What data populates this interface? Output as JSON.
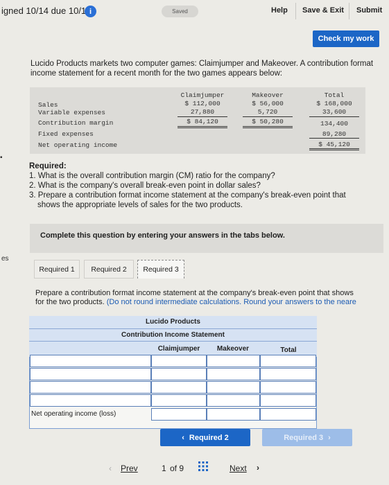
{
  "header": {
    "assignment": "igned 10/14 due 10/19",
    "info_icon": "i",
    "saved": "Saved",
    "help": "Help",
    "save_exit": "Save & Exit",
    "submit": "Submit"
  },
  "check_button": "Check my work",
  "intro": "Lucido Products markets two computer games: Claimjumper and Makeover. A contribution format income statement for a recent month for the two games appears below:",
  "given_table": {
    "columns": [
      "Claimjumper",
      "Makeover",
      "Total"
    ],
    "rows": [
      {
        "label": "Sales",
        "claimjumper": "$ 112,000",
        "makeover": "$ 56,000",
        "total": "$ 168,000"
      },
      {
        "label": "Variable expenses",
        "claimjumper": "27,880",
        "makeover": "5,720",
        "total": "33,600"
      },
      {
        "label": "Contribution margin",
        "claimjumper": "$ 84,120",
        "makeover": "$ 50,280",
        "total": "134,400"
      },
      {
        "label": "Fixed expenses",
        "claimjumper": "",
        "makeover": "",
        "total": "89,280"
      },
      {
        "label": "Net operating income",
        "claimjumper": "",
        "makeover": "",
        "total": "$ 45,120"
      }
    ]
  },
  "required": {
    "heading": "Required:",
    "q1": "1. What is the overall contribution margin (CM) ratio for the company?",
    "q2": "2. What is the company's overall break-even point in dollar sales?",
    "q3a": "3. Prepare a contribution format income statement at the company's break-even point that",
    "q3b": "shows the appropriate levels of sales for the two products."
  },
  "complete_text": "Complete this question by entering your answers in the tabs below.",
  "tabs": [
    "Required 1",
    "Required 2",
    "Required 3"
  ],
  "prepare": {
    "line1": "Prepare a contribution format income statement at the company's break-even point that shows",
    "line2": "for the two products.",
    "line2_blue": "(Do not round intermediate calculations. Round your answers to the neare"
  },
  "statement": {
    "company": "Lucido Products",
    "title": "Contribution Income Statement",
    "columns": [
      "Claimjumper",
      "Makeover",
      "Total"
    ],
    "last_row_label": "Net operating income (loss)"
  },
  "nav": {
    "prev_req": "Required 2",
    "next_req": "Required 3",
    "prev": "Prev",
    "page": "1",
    "of": "of 9",
    "next": "Next"
  },
  "side_marker": "es",
  "colors": {
    "primary": "#1c66c6",
    "disabled": "#9dbde8",
    "header_blue": "#d6e2f3"
  }
}
